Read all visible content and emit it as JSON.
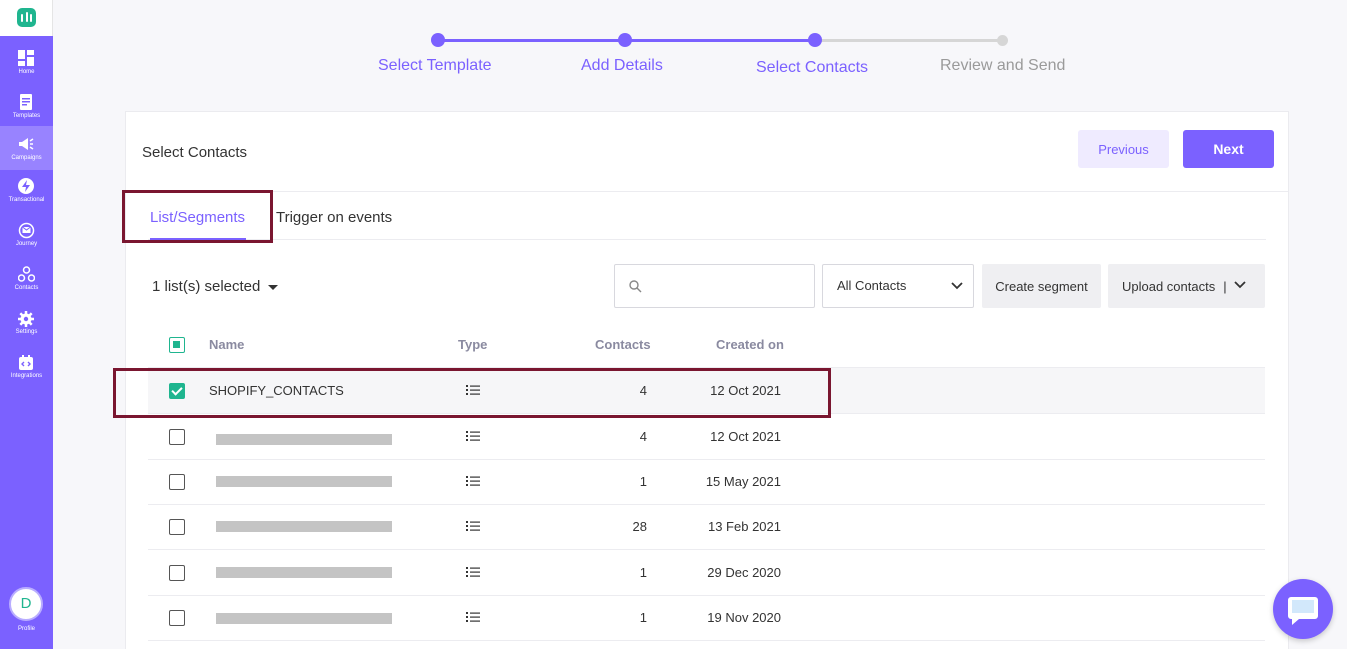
{
  "sidebar": {
    "items": [
      {
        "label": "Home",
        "icon": "dashboard-icon"
      },
      {
        "label": "Templates",
        "icon": "template-icon"
      },
      {
        "label": "Campaigns",
        "icon": "megaphone-icon"
      },
      {
        "label": "Transactional",
        "icon": "bolt-icon"
      },
      {
        "label": "Journey",
        "icon": "journey-icon"
      },
      {
        "label": "Contacts",
        "icon": "contacts-icon"
      },
      {
        "label": "Settings",
        "icon": "gear-icon"
      },
      {
        "label": "Integrations",
        "icon": "integrations-icon"
      }
    ],
    "active": "Campaigns",
    "profile": {
      "initial": "D",
      "label": "Profile"
    }
  },
  "stepper": {
    "steps": [
      {
        "label": "Select Template",
        "state": "done"
      },
      {
        "label": "Add Details",
        "state": "done"
      },
      {
        "label": "Select Contacts",
        "state": "current"
      },
      {
        "label": "Review and Send",
        "state": "todo"
      }
    ]
  },
  "card": {
    "title": "Select Contacts",
    "previous_label": "Previous",
    "next_label": "Next"
  },
  "tabs": {
    "active": "List/Segments",
    "other": "Trigger on events"
  },
  "toolbar": {
    "selected_text": "1 list(s) selected",
    "search_value": "",
    "filter_value": "All Contacts",
    "create_segment": "Create segment",
    "upload_contacts": "Upload contacts",
    "upload_sep": "|"
  },
  "table": {
    "headers": {
      "name": "Name",
      "type": "Type",
      "contacts": "Contacts",
      "created": "Created on"
    },
    "rows": [
      {
        "name": "SHOPIFY_CONTACTS",
        "contacts": "4",
        "created": "12 Oct 2021",
        "checked": true,
        "redacted": false
      },
      {
        "name": "",
        "contacts": "4",
        "created": "12 Oct 2021",
        "checked": false,
        "redacted": true
      },
      {
        "name": "",
        "contacts": "1",
        "created": "15 May 2021",
        "checked": false,
        "redacted": true
      },
      {
        "name": "",
        "contacts": "28",
        "created": "13 Feb 2021",
        "checked": false,
        "redacted": true
      },
      {
        "name": "",
        "contacts": "1",
        "created": "29 Dec 2020",
        "checked": false,
        "redacted": true
      },
      {
        "name": "",
        "contacts": "1",
        "created": "19 Nov 2020",
        "checked": false,
        "redacted": true
      }
    ]
  },
  "colors": {
    "accent": "#7b61ff",
    "brand_green": "#1fb58f",
    "highlight": "#7a1630"
  }
}
